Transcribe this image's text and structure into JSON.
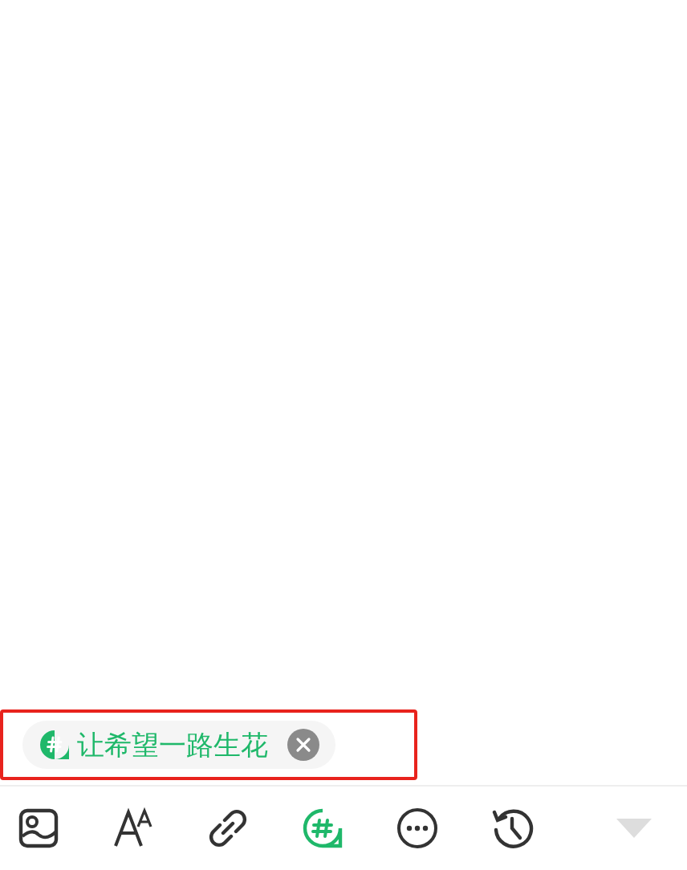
{
  "topic_chip": {
    "label": "让希望一路生花"
  },
  "toolbar": [
    {
      "kind": "image",
      "selected": false
    },
    {
      "kind": "font",
      "selected": false
    },
    {
      "kind": "link",
      "selected": false
    },
    {
      "kind": "topic",
      "selected": true
    },
    {
      "kind": "more",
      "selected": false
    },
    {
      "kind": "history",
      "selected": false
    }
  ]
}
